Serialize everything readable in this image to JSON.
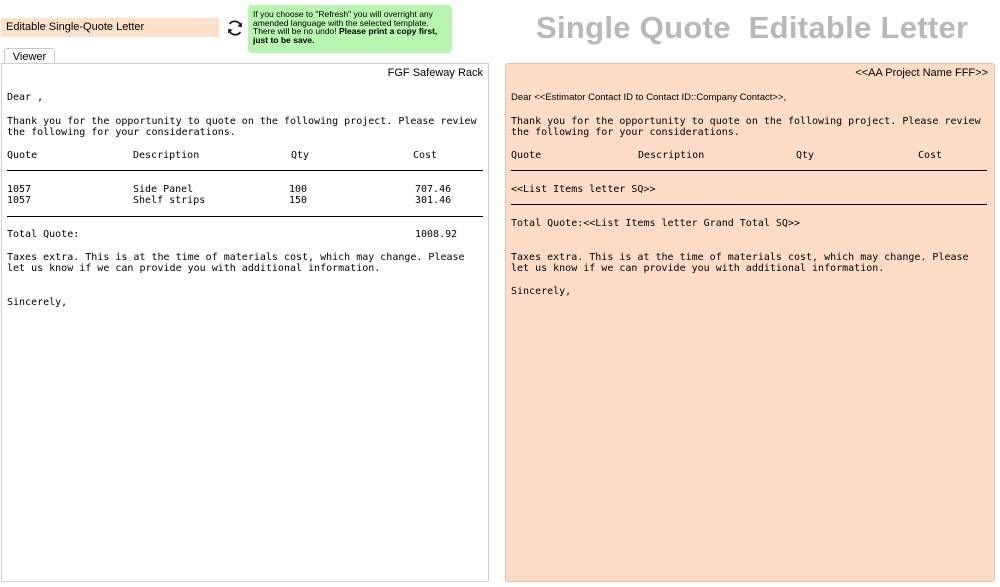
{
  "header": {
    "layout_name": "Editable Single-Quote Letter",
    "refresh_icon": "refresh-icon",
    "warning_normal": "If you choose to \"Refresh\" you will overright any amended language with the selected template. There will be no undo!",
    "warning_bold": "Please print a copy first, just to be save.",
    "big_title": "Single Quote  Editable Letter"
  },
  "tabs": [
    {
      "label": "Viewer"
    }
  ],
  "viewer": {
    "project_name": "FGF Safeway Rack",
    "greeting": "Dear ,",
    "intro": "Thank you for the opportunity to quote on the following project. Please review the following for your considerations.",
    "columns": [
      "Quote",
      "Description",
      "Qty",
      "Cost"
    ],
    "rows": [
      {
        "quote": "1057",
        "description": "Side Panel",
        "qty": "100",
        "cost": "707.46"
      },
      {
        "quote": "1057",
        "description": "Shelf strips",
        "qty": "150",
        "cost": "301.46"
      }
    ],
    "total_label": "Total Quote:",
    "total_value": "1008.92",
    "closing": "Taxes extra.  This is at the time of materials cost, which may change.  Please let us know if we can provide you with additional information.",
    "signoff": "Sincerely,"
  },
  "letter": {
    "project_name": "<<AA Project Name FFF>>",
    "greeting": "Dear <<Estimator Contact ID to Contact ID::Company Contact>>,",
    "intro": "Thank you for the opportunity to quote on the following project. Please review the following for your considerations.",
    "columns": [
      "Quote",
      "Description",
      "Qty",
      "Cost"
    ],
    "items_placeholder": "<<List Items letter SQ>>",
    "total_line": "Total Quote:<<List Items letter Grand Total SQ>>",
    "closing": "Taxes extra.  This is at the time of materials cost, which may change.  Please let us know if we can provide you with additional information.",
    "signoff": "Sincerely,"
  },
  "colors": {
    "title_field_bg": "#fce0cc",
    "warning_bg": "#b8f5b0",
    "letter_bg": "#fcdcc6",
    "big_title": "#b8b8b8"
  }
}
